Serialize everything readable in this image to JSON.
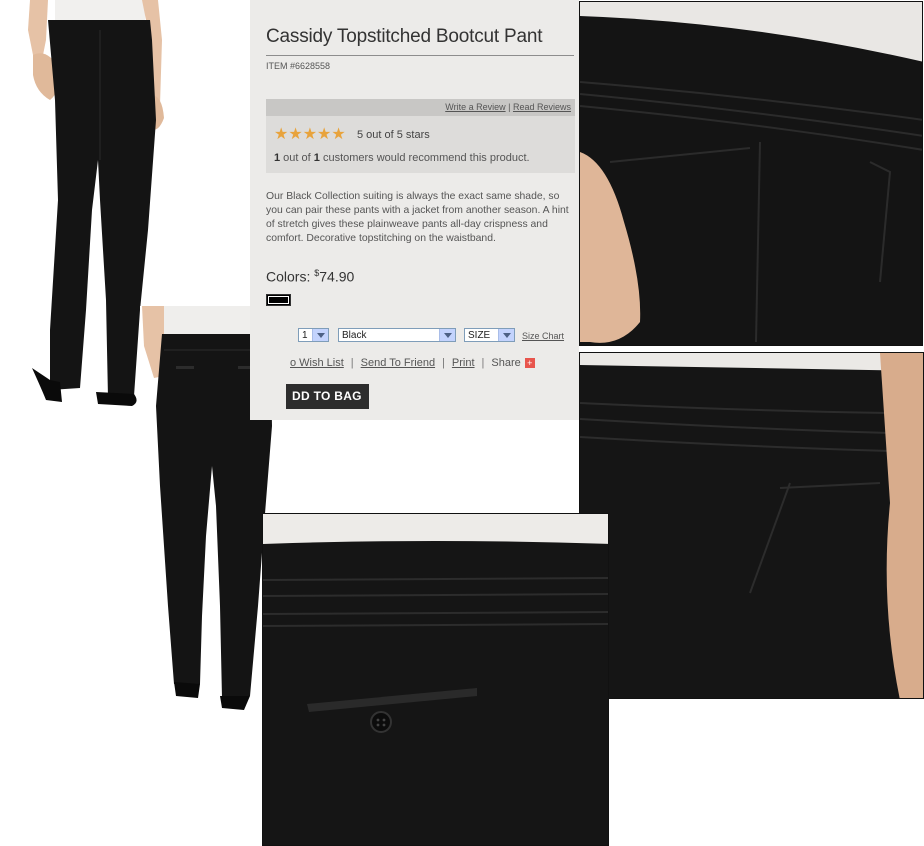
{
  "product": {
    "title": "Cassidy Topstitched Bootcut Pant",
    "item_number": "ITEM #6628558",
    "reviews": {
      "write_link": "Write a Review",
      "separator": "|",
      "read_link": "Read Reviews",
      "stars_glyphs": "★★★★★",
      "rating": 5,
      "rating_text": "5 out of 5 stars",
      "recommend_count": "1",
      "recommend_mid": " out of ",
      "recommend_total": "1",
      "recommend_tail": " customers would recommend this product."
    },
    "description": "Our Black Collection suiting is always the exact same shade, so you can pair these pants with a jacket from another season. A hint of stretch gives these plainweave pants all-day crispness and comfort. Decorative topstitching on the waistband.",
    "colors_label": "Colors:",
    "currency": "$",
    "price": "74.90",
    "swatch_color": "#000000",
    "quantity": "1",
    "color_select": "Black",
    "size_select": "SIZE",
    "size_chart_link": "Size Chart",
    "actions": {
      "wish_list": "o Wish List",
      "send_to_friend": "Send To Friend",
      "print": "Print",
      "share": "Share",
      "share_icon": "+",
      "sep": "|"
    },
    "add_to_bag": "DD TO BAG"
  },
  "colors": {
    "panel_bg": "#ecebe9",
    "star": "#e8a33c",
    "button": "#2d2d2d"
  }
}
